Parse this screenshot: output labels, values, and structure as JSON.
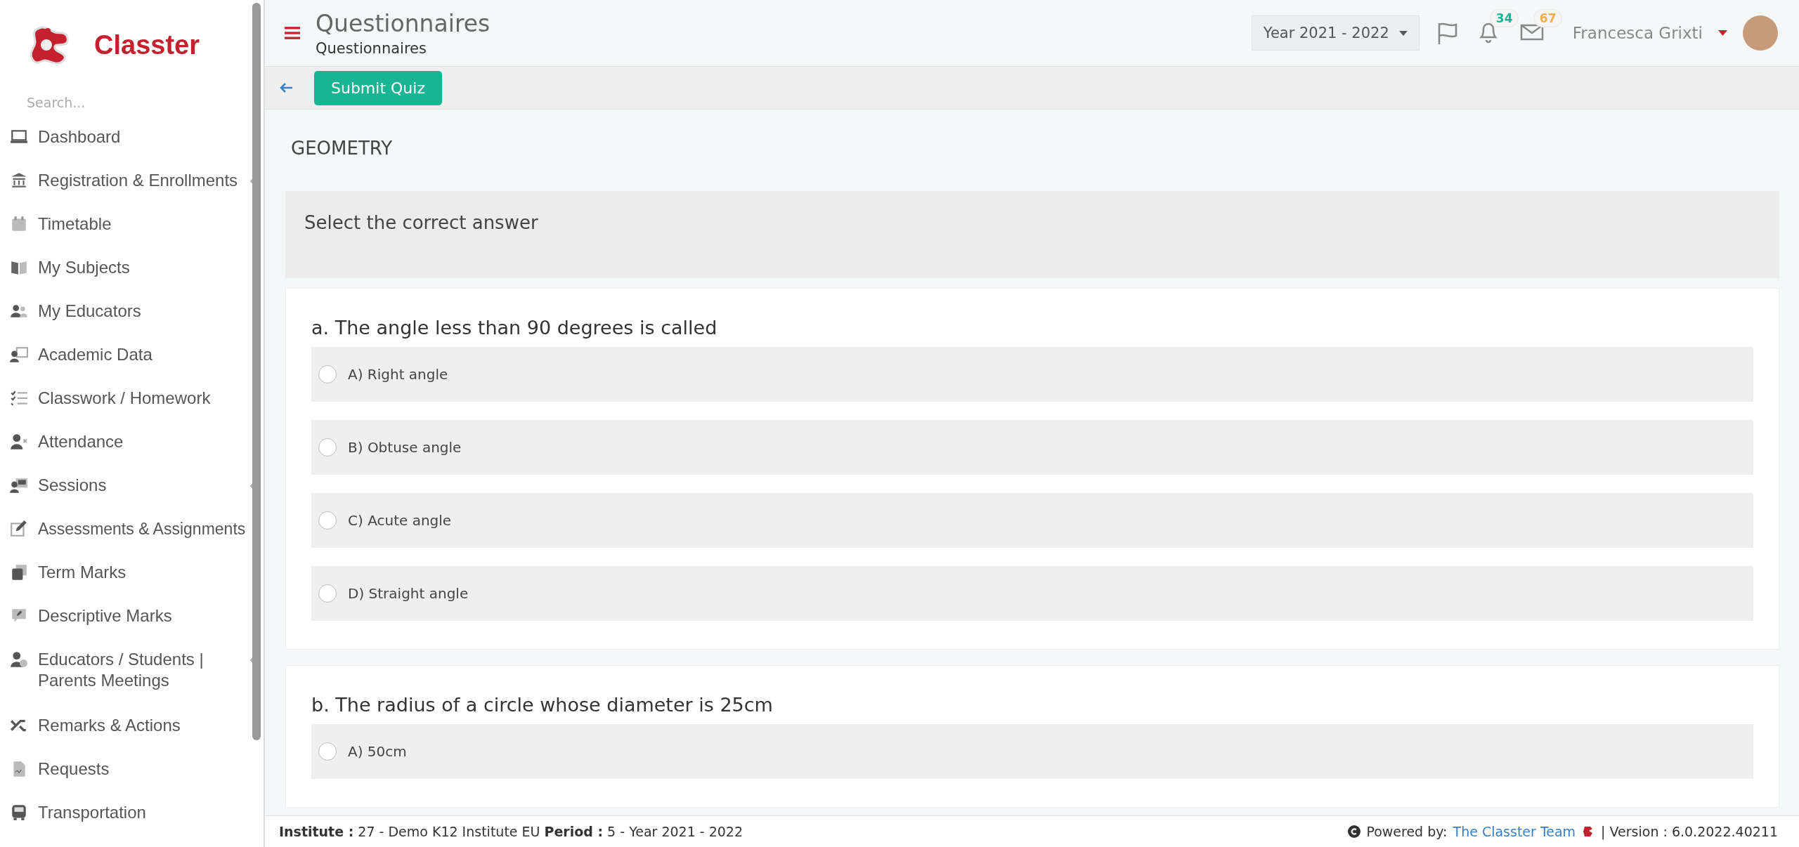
{
  "sidebar": {
    "brand": "Classter",
    "search": {
      "placeholder": "Search..."
    },
    "items": [
      {
        "label": "Dashboard",
        "kind": "laptop",
        "expandable": false
      },
      {
        "label": "Registration & Enrollments",
        "kind": "bank",
        "expandable": true
      },
      {
        "label": "Timetable",
        "kind": "calendar",
        "expandable": false
      },
      {
        "label": "My Subjects",
        "kind": "book",
        "expandable": false
      },
      {
        "label": "My Educators",
        "kind": "users",
        "expandable": false
      },
      {
        "label": "Academic Data",
        "kind": "chart",
        "expandable": false
      },
      {
        "label": "Classwork / Homework",
        "kind": "list",
        "expandable": false
      },
      {
        "label": "Attendance",
        "kind": "userx",
        "expandable": false
      },
      {
        "label": "Sessions",
        "kind": "board",
        "expandable": true
      },
      {
        "label": "Assessments & Assignments",
        "kind": "edit",
        "expandable": false
      },
      {
        "label": "Term Marks",
        "kind": "cards",
        "expandable": false
      },
      {
        "label": "Descriptive Marks",
        "kind": "comment",
        "expandable": false
      },
      {
        "label": "Educators / Students | Parents Meetings",
        "kind": "userclock",
        "expandable": true
      },
      {
        "label": "Remarks & Actions",
        "kind": "shuffle",
        "expandable": false
      },
      {
        "label": "Requests",
        "kind": "doc",
        "expandable": false
      },
      {
        "label": "Transportation",
        "kind": "bus",
        "expandable": false
      }
    ]
  },
  "header": {
    "title": "Questionnaires",
    "breadcrumb": "Questionnaires",
    "year": "Year 2021 - 2022",
    "notifications": [
      {
        "kind": "bell",
        "count": "34",
        "color": "#1ab394"
      },
      {
        "kind": "mail",
        "count": "67",
        "color": "#f0ad4e"
      }
    ],
    "user": "Francesca Grixti"
  },
  "toolbar": {
    "submit": "Submit Quiz"
  },
  "quiz": {
    "subject": "GEOMETRY",
    "instruction": "Select the correct answer",
    "questions": [
      {
        "text": "a. The angle less than 90 degrees is called",
        "options": [
          {
            "label": "A) Right angle",
            "selected": false
          },
          {
            "label": "B) Obtuse angle",
            "selected": false
          },
          {
            "label": "C) Acute angle",
            "selected": false
          },
          {
            "label": "D) Straight angle",
            "selected": false
          }
        ]
      },
      {
        "text": "b. The radius of a circle whose diameter is 25cm",
        "options": [
          {
            "label": "A) 50cm",
            "selected": false
          }
        ]
      }
    ]
  },
  "footer": {
    "info": "**Institute :** 27 - Demo K12 Institute EU **Period :** 5 - Year 2021 - 2022",
    "powered": "Powered by:",
    "team": "The Classter Team",
    "version": "| Version : 6.0.2022.40211"
  }
}
